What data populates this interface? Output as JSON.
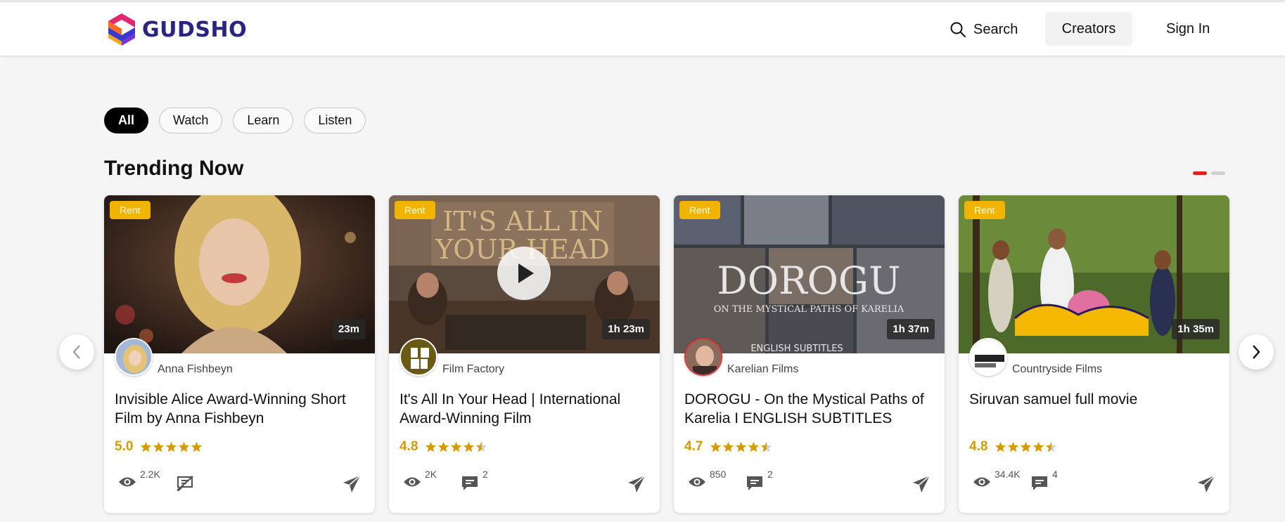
{
  "brand": {
    "name": "GUDSHO"
  },
  "nav": {
    "search_label": "Search",
    "creators_label": "Creators",
    "signin_label": "Sign In"
  },
  "filters": [
    {
      "label": "All",
      "active": true
    },
    {
      "label": "Watch",
      "active": false
    },
    {
      "label": "Learn",
      "active": false
    },
    {
      "label": "Listen",
      "active": false
    }
  ],
  "section": {
    "title": "Trending Now",
    "pages": 2,
    "current_page": 1
  },
  "colors": {
    "brand": "#2b2582",
    "rent_badge": "#f0b400",
    "rating": "#d69a00",
    "pager_active": "#e02020"
  },
  "cards": [
    {
      "badge": "Rent",
      "duration": "23m",
      "creator": "Anna Fishbeyn",
      "title": "Invisible Alice Award-Winning Short Film by Anna Fishbeyn",
      "rating": "5.0",
      "stars": 5,
      "views": "2.2K",
      "comments": "",
      "comments_disabled": true
    },
    {
      "badge": "Rent",
      "duration": "1h 23m",
      "creator": "Film Factory",
      "title": "It's All In Your Head | International Award-Winning Film",
      "rating": "4.8",
      "stars": 4.5,
      "views": "2K",
      "comments": "2",
      "comments_disabled": false
    },
    {
      "badge": "Rent",
      "duration": "1h 37m",
      "creator": "Karelian Films",
      "title": "DOROGU - On the Mystical Paths of Karelia I ENGLISH SUBTITLES",
      "rating": "4.7",
      "stars": 4.5,
      "views": "850",
      "comments": "2",
      "comments_disabled": false
    },
    {
      "badge": "Rent",
      "duration": "1h 35m",
      "creator": "Countryside Films",
      "title": "Siruvan samuel full movie",
      "rating": "4.8",
      "stars": 4.5,
      "views": "34.4K",
      "comments": "4",
      "comments_disabled": false
    }
  ],
  "icons": {
    "search": "search-icon",
    "prev": "chevron-left-icon",
    "next": "chevron-right-icon",
    "views": "eye-icon",
    "comments": "comment-icon",
    "share": "send-icon",
    "play": "play-icon"
  }
}
